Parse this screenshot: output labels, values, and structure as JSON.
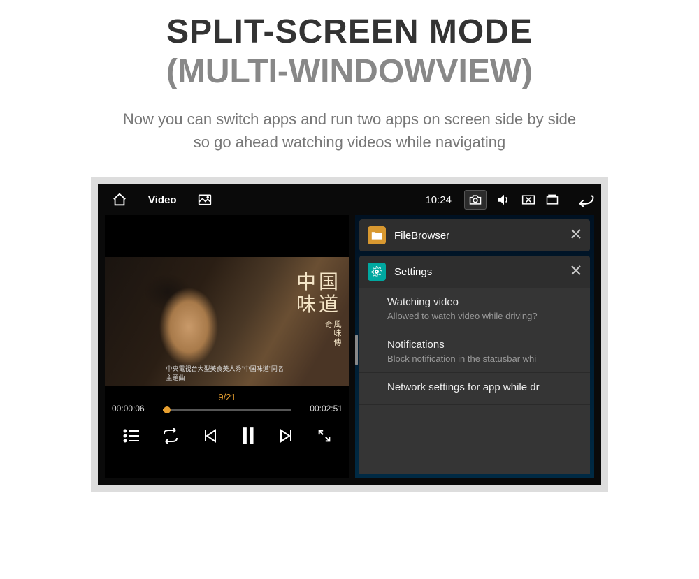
{
  "heading": {
    "title": "SPLIT-SCREEN MODE",
    "subtitle": "(MULTI-WINDOWVIEW)",
    "desc_line1": "Now you can switch apps and run two apps on screen side by side",
    "desc_line2": "so go ahead watching videos while navigating"
  },
  "status": {
    "app_label": "Video",
    "time": "10:24"
  },
  "video": {
    "overlay_l1": "中国",
    "overlay_l2": "味道",
    "overlay_small": "風味傳奇",
    "caption": "中央電視台大型美食美人秀\"中国味道\"同名主題曲",
    "elapsed": "00:00:06",
    "total": "00:02:51",
    "counter": "9/21"
  },
  "apps": {
    "filebrowser": "FileBrowser",
    "settings": "Settings"
  },
  "settings_list": [
    {
      "title": "Watching video",
      "sub": "Allowed to watch video while driving?"
    },
    {
      "title": "Notifications",
      "sub": "Block notification in the statusbar whi"
    },
    {
      "title": "Network settings for app while dr",
      "sub": ""
    }
  ]
}
